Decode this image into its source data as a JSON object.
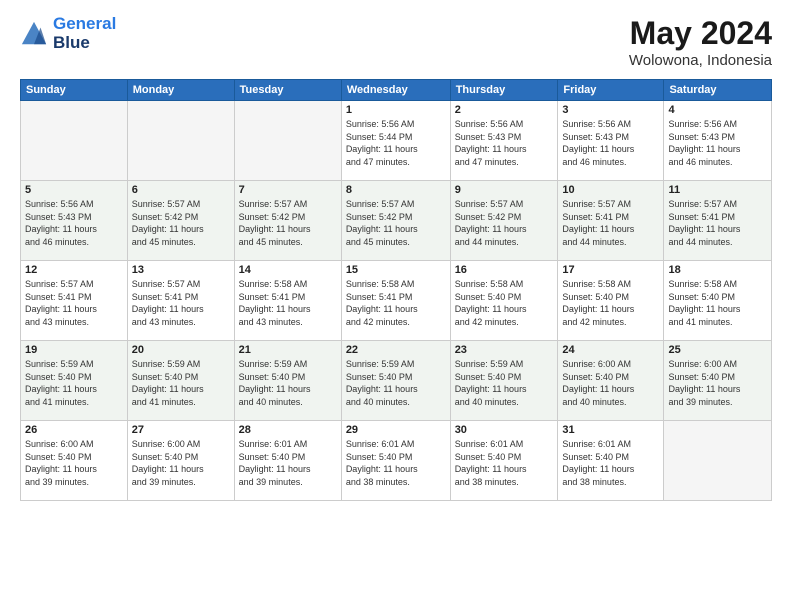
{
  "header": {
    "logo_line1": "General",
    "logo_line2": "Blue",
    "month": "May 2024",
    "location": "Wolowona, Indonesia"
  },
  "weekdays": [
    "Sunday",
    "Monday",
    "Tuesday",
    "Wednesday",
    "Thursday",
    "Friday",
    "Saturday"
  ],
  "weeks": [
    [
      {
        "day": "",
        "info": ""
      },
      {
        "day": "",
        "info": ""
      },
      {
        "day": "",
        "info": ""
      },
      {
        "day": "1",
        "info": "Sunrise: 5:56 AM\nSunset: 5:44 PM\nDaylight: 11 hours\nand 47 minutes."
      },
      {
        "day": "2",
        "info": "Sunrise: 5:56 AM\nSunset: 5:43 PM\nDaylight: 11 hours\nand 47 minutes."
      },
      {
        "day": "3",
        "info": "Sunrise: 5:56 AM\nSunset: 5:43 PM\nDaylight: 11 hours\nand 46 minutes."
      },
      {
        "day": "4",
        "info": "Sunrise: 5:56 AM\nSunset: 5:43 PM\nDaylight: 11 hours\nand 46 minutes."
      }
    ],
    [
      {
        "day": "5",
        "info": "Sunrise: 5:56 AM\nSunset: 5:43 PM\nDaylight: 11 hours\nand 46 minutes."
      },
      {
        "day": "6",
        "info": "Sunrise: 5:57 AM\nSunset: 5:42 PM\nDaylight: 11 hours\nand 45 minutes."
      },
      {
        "day": "7",
        "info": "Sunrise: 5:57 AM\nSunset: 5:42 PM\nDaylight: 11 hours\nand 45 minutes."
      },
      {
        "day": "8",
        "info": "Sunrise: 5:57 AM\nSunset: 5:42 PM\nDaylight: 11 hours\nand 45 minutes."
      },
      {
        "day": "9",
        "info": "Sunrise: 5:57 AM\nSunset: 5:42 PM\nDaylight: 11 hours\nand 44 minutes."
      },
      {
        "day": "10",
        "info": "Sunrise: 5:57 AM\nSunset: 5:41 PM\nDaylight: 11 hours\nand 44 minutes."
      },
      {
        "day": "11",
        "info": "Sunrise: 5:57 AM\nSunset: 5:41 PM\nDaylight: 11 hours\nand 44 minutes."
      }
    ],
    [
      {
        "day": "12",
        "info": "Sunrise: 5:57 AM\nSunset: 5:41 PM\nDaylight: 11 hours\nand 43 minutes."
      },
      {
        "day": "13",
        "info": "Sunrise: 5:57 AM\nSunset: 5:41 PM\nDaylight: 11 hours\nand 43 minutes."
      },
      {
        "day": "14",
        "info": "Sunrise: 5:58 AM\nSunset: 5:41 PM\nDaylight: 11 hours\nand 43 minutes."
      },
      {
        "day": "15",
        "info": "Sunrise: 5:58 AM\nSunset: 5:41 PM\nDaylight: 11 hours\nand 42 minutes."
      },
      {
        "day": "16",
        "info": "Sunrise: 5:58 AM\nSunset: 5:40 PM\nDaylight: 11 hours\nand 42 minutes."
      },
      {
        "day": "17",
        "info": "Sunrise: 5:58 AM\nSunset: 5:40 PM\nDaylight: 11 hours\nand 42 minutes."
      },
      {
        "day": "18",
        "info": "Sunrise: 5:58 AM\nSunset: 5:40 PM\nDaylight: 11 hours\nand 41 minutes."
      }
    ],
    [
      {
        "day": "19",
        "info": "Sunrise: 5:59 AM\nSunset: 5:40 PM\nDaylight: 11 hours\nand 41 minutes."
      },
      {
        "day": "20",
        "info": "Sunrise: 5:59 AM\nSunset: 5:40 PM\nDaylight: 11 hours\nand 41 minutes."
      },
      {
        "day": "21",
        "info": "Sunrise: 5:59 AM\nSunset: 5:40 PM\nDaylight: 11 hours\nand 40 minutes."
      },
      {
        "day": "22",
        "info": "Sunrise: 5:59 AM\nSunset: 5:40 PM\nDaylight: 11 hours\nand 40 minutes."
      },
      {
        "day": "23",
        "info": "Sunrise: 5:59 AM\nSunset: 5:40 PM\nDaylight: 11 hours\nand 40 minutes."
      },
      {
        "day": "24",
        "info": "Sunrise: 6:00 AM\nSunset: 5:40 PM\nDaylight: 11 hours\nand 40 minutes."
      },
      {
        "day": "25",
        "info": "Sunrise: 6:00 AM\nSunset: 5:40 PM\nDaylight: 11 hours\nand 39 minutes."
      }
    ],
    [
      {
        "day": "26",
        "info": "Sunrise: 6:00 AM\nSunset: 5:40 PM\nDaylight: 11 hours\nand 39 minutes."
      },
      {
        "day": "27",
        "info": "Sunrise: 6:00 AM\nSunset: 5:40 PM\nDaylight: 11 hours\nand 39 minutes."
      },
      {
        "day": "28",
        "info": "Sunrise: 6:01 AM\nSunset: 5:40 PM\nDaylight: 11 hours\nand 39 minutes."
      },
      {
        "day": "29",
        "info": "Sunrise: 6:01 AM\nSunset: 5:40 PM\nDaylight: 11 hours\nand 38 minutes."
      },
      {
        "day": "30",
        "info": "Sunrise: 6:01 AM\nSunset: 5:40 PM\nDaylight: 11 hours\nand 38 minutes."
      },
      {
        "day": "31",
        "info": "Sunrise: 6:01 AM\nSunset: 5:40 PM\nDaylight: 11 hours\nand 38 minutes."
      },
      {
        "day": "",
        "info": ""
      }
    ]
  ]
}
